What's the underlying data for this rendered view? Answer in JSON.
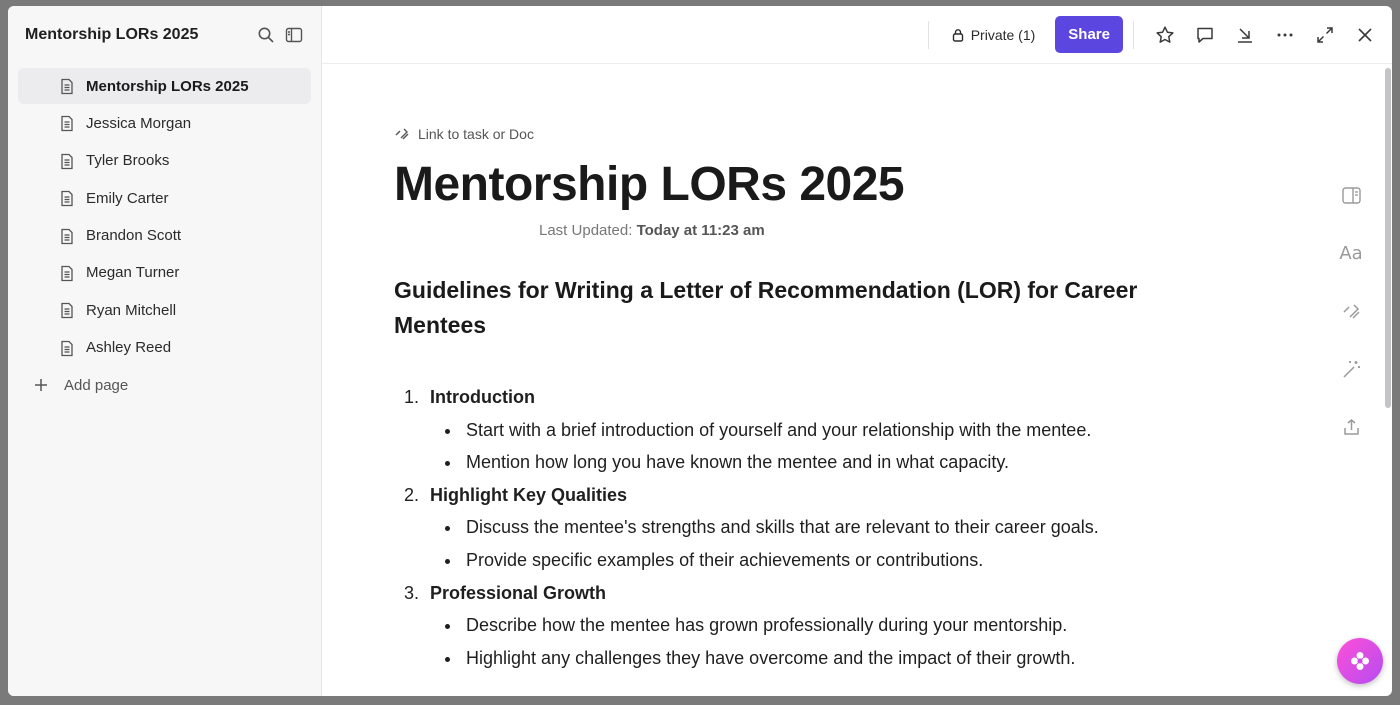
{
  "sidebar": {
    "title": "Mentorship LORs 2025",
    "items": [
      {
        "label": "Mentorship LORs 2025"
      },
      {
        "label": "Jessica Morgan"
      },
      {
        "label": "Tyler Brooks"
      },
      {
        "label": "Emily Carter"
      },
      {
        "label": "Brandon Scott"
      },
      {
        "label": "Megan Turner"
      },
      {
        "label": "Ryan Mitchell"
      },
      {
        "label": "Ashley Reed"
      }
    ],
    "add_page": "Add page"
  },
  "topbar": {
    "private_label": "Private (1)",
    "share_label": "Share"
  },
  "doc": {
    "link_label": "Link to task or Doc",
    "title": "Mentorship LORs 2025",
    "updated_label": "Last Updated:",
    "updated_value": "Today at 11:23 am",
    "heading": "Guidelines for Writing a Letter of Recommendation (LOR) for Career Mentees",
    "sections": [
      {
        "title": "Introduction",
        "bullets": [
          "Start with a brief introduction of yourself and your relationship with the mentee.",
          "Mention how long you have known the mentee and in what capacity."
        ]
      },
      {
        "title": "Highlight Key Qualities",
        "bullets": [
          "Discuss the mentee's strengths and skills that are relevant to their career goals.",
          "Provide specific examples of their achievements or contributions."
        ]
      },
      {
        "title": "Professional Growth",
        "bullets": [
          "Describe how the mentee has grown professionally during your mentorship.",
          "Highlight any challenges they have overcome and the impact of their growth."
        ]
      }
    ]
  },
  "rail": {
    "font_label": "Aa"
  },
  "colors": {
    "accent": "#5b47e0",
    "active_item_bg": "#ececee"
  }
}
